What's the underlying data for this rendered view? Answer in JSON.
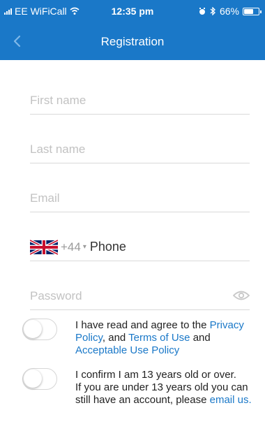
{
  "status_bar": {
    "carrier": "EE WiFiCall",
    "time": "12:35 pm",
    "battery_percent": "66%",
    "battery_level": 0.66
  },
  "nav": {
    "title": "Registration",
    "back_icon": "chevron-left-icon"
  },
  "form": {
    "first_name": {
      "placeholder": "First name",
      "value": ""
    },
    "last_name": {
      "placeholder": "Last name",
      "value": ""
    },
    "email": {
      "placeholder": "Email",
      "value": ""
    },
    "phone": {
      "country_flag": "uk-flag-icon",
      "dial_code": "+44",
      "caret": "▾",
      "placeholder": "Phone",
      "value": ""
    },
    "password": {
      "placeholder": "Password",
      "value": "",
      "visibility_icon": "eye-icon"
    }
  },
  "consents": {
    "terms": {
      "checked": false,
      "text_1": "I have read and agree to the ",
      "privacy_link": "Privacy Policy",
      "text_2": ", and ",
      "terms_link": "Terms of Use",
      "text_3": " and ",
      "aup_link": "Acceptable Use Policy"
    },
    "age": {
      "checked": false,
      "line_1": "I confirm I am 13 years old or over.",
      "line_2": "If you are under 13 years old you can still have an account, please ",
      "email_link": "email us."
    }
  },
  "colors": {
    "primary": "#1a78c8",
    "placeholder": "#c2c2c2",
    "divider": "#d9d9d9"
  }
}
